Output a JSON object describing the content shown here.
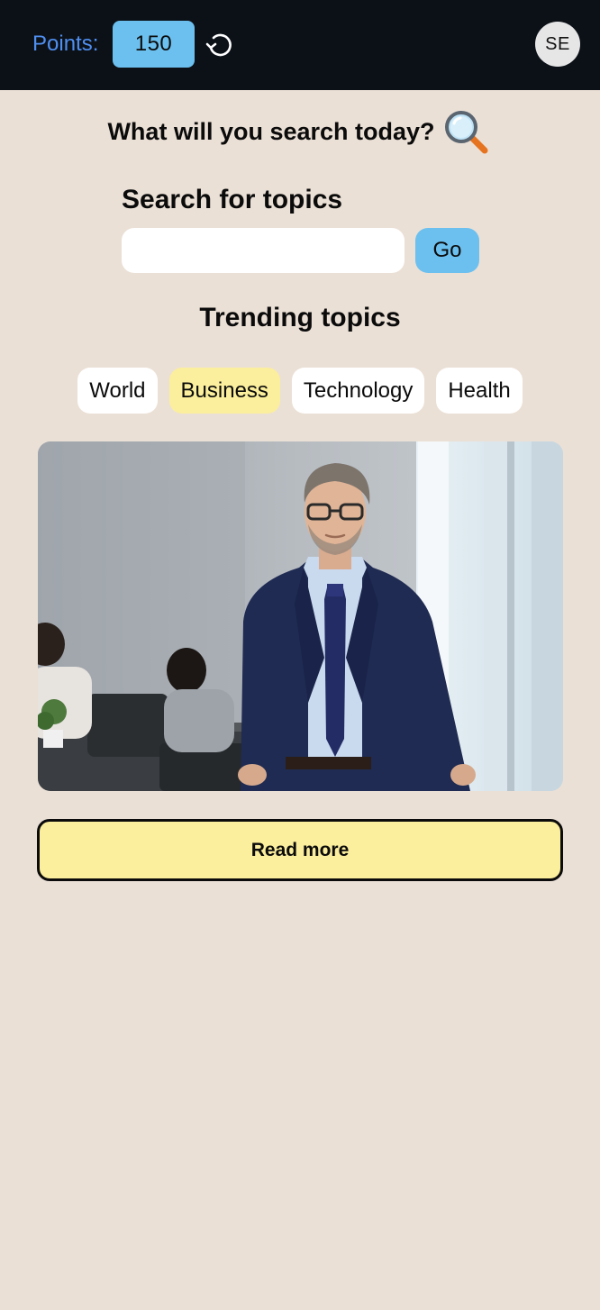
{
  "header": {
    "points_label": "Points:",
    "points_value": "150",
    "refresh_icon": "refresh-icon",
    "avatar_initials": "SE"
  },
  "main": {
    "headline": "What will you search today?",
    "headline_icon": "magnifying-glass-icon",
    "search_title": "Search for topics",
    "search_value": "",
    "search_placeholder": "",
    "go_label": "Go",
    "trending_title": "Trending topics",
    "topics": [
      {
        "label": "World",
        "active": false
      },
      {
        "label": "Business",
        "active": true
      },
      {
        "label": "Technology",
        "active": false
      },
      {
        "label": "Health",
        "active": false
      }
    ],
    "article_image": "photo of a businessman in a navy suit standing in an office",
    "read_more_label": "Read more"
  },
  "colors": {
    "background": "#ebe0d6",
    "topbar": "#0c1118",
    "accent_blue": "#6cc0ef",
    "points_label_blue": "#4f8ff0",
    "active_chip": "#fbee9c"
  }
}
